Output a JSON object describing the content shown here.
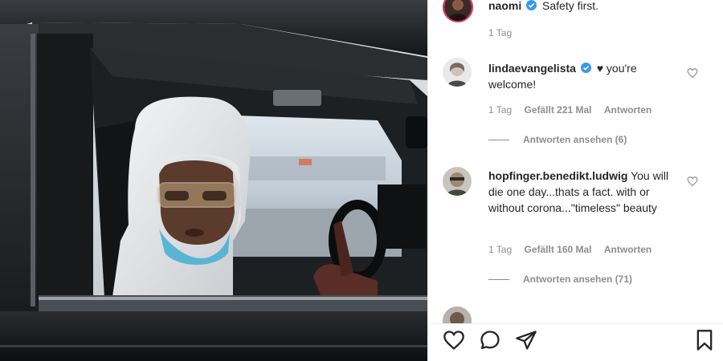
{
  "post": {
    "author": "naomi",
    "caption": "Safety first.",
    "time": "1 Tag"
  },
  "comments": [
    {
      "username": "lindaevangelista",
      "verified": true,
      "text": "♥ you're welcome!",
      "time": "1 Tag",
      "likes": "Gefällt 221 Mal",
      "reply_label": "Antworten",
      "view_replies": "Antworten ansehen (6)"
    },
    {
      "username": "hopfinger.benedikt.ludwig",
      "verified": false,
      "text": "You will die one day...thats a fact. with or without corona...\"timeless\" beauty",
      "time": "1 Tag",
      "likes": "Gefällt 160 Mal",
      "reply_label": "Antworten",
      "view_replies": "Antworten ansehen (71)"
    }
  ],
  "icons": {
    "like": "heart-icon",
    "comment": "comment-icon",
    "share": "share-icon",
    "save": "bookmark-icon",
    "comment_like": "heart-outline-icon",
    "verified": "verified-badge-icon"
  },
  "colors": {
    "verified": "#3897f0",
    "muted_text": "#8e8e8e",
    "primary_text": "#262626"
  }
}
